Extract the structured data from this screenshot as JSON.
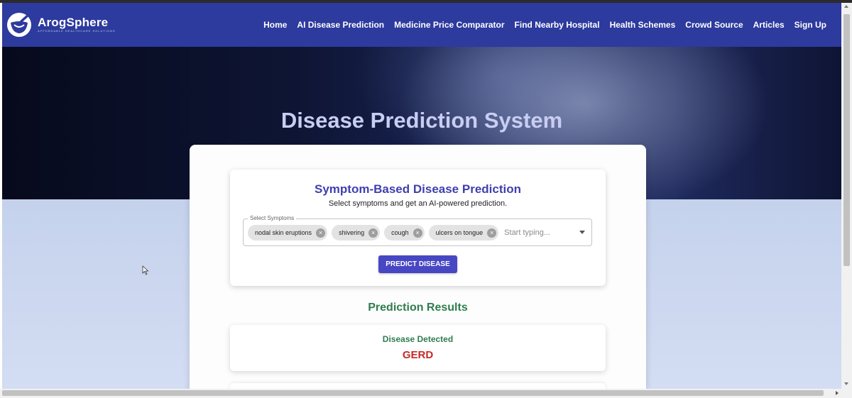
{
  "brand": {
    "name": "ArogSphere",
    "tagline": "AFFORDABLE HEALTHCARE SOLUTIONS"
  },
  "nav": {
    "links": [
      "Home",
      "AI Disease Prediction",
      "Medicine Price Comparator",
      "Find Nearby Hospital",
      "Health Schemes",
      "Crowd Source",
      "Articles",
      "Sign Up"
    ]
  },
  "hero": {
    "title": "Disease Prediction System"
  },
  "form": {
    "title": "Symptom-Based Disease Prediction",
    "subtitle": "Select symptoms and get an AI-powered prediction.",
    "select_label": "Select Symptoms",
    "selected_symptoms": [
      "nodal skin eruptions",
      "shivering",
      "cough",
      "ulcers on tongue"
    ],
    "input_placeholder": "Start typing...",
    "predict_button": "PREDICT DISEASE"
  },
  "results": {
    "title": "Prediction Results",
    "label": "Disease Detected",
    "disease": "GERD"
  },
  "colors": {
    "navbar": "#2d3a9e",
    "accent": "#4747c4",
    "results_green": "#2e7d4e",
    "disease_red": "#c62828"
  }
}
